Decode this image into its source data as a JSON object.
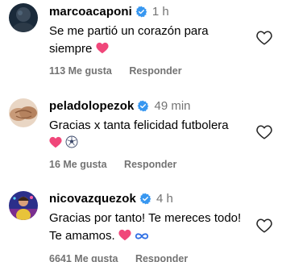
{
  "comments": [
    {
      "username": "marcoacaponi",
      "time": "1 h",
      "text_line1": "Se me partió un corazón para",
      "text_line2": "siempre",
      "likes": "113 Me gusta",
      "reply": "Responder",
      "avatar_icon": "profile-photo-dark",
      "emojis": [
        "pink-heart-emoji"
      ]
    },
    {
      "username": "peladolopezok",
      "time": "49 min",
      "text_line1": "Gracias x tanta felicidad futbolera",
      "text_line2": "",
      "likes": "16 Me gusta",
      "reply": "Responder",
      "avatar_icon": "profile-photo-handshake",
      "emojis": [
        "pink-heart-emoji",
        "soccer-ball-emoji"
      ]
    },
    {
      "username": "nicovazquezok",
      "time": "4 h",
      "text_line1": "Gracias por tanto! Te mereces todo!",
      "text_line2": "Te amamos.",
      "likes": "6641 Me gusta",
      "reply": "Responder",
      "avatar_icon": "profile-photo-person",
      "emojis": [
        "pink-heart-emoji",
        "infinity-emoji"
      ]
    }
  ],
  "colors": {
    "verified": "#3897f0",
    "secondary_text": "#737373",
    "heart_emoji": "#f0477a",
    "infinity_emoji": "#2f6fe4"
  }
}
